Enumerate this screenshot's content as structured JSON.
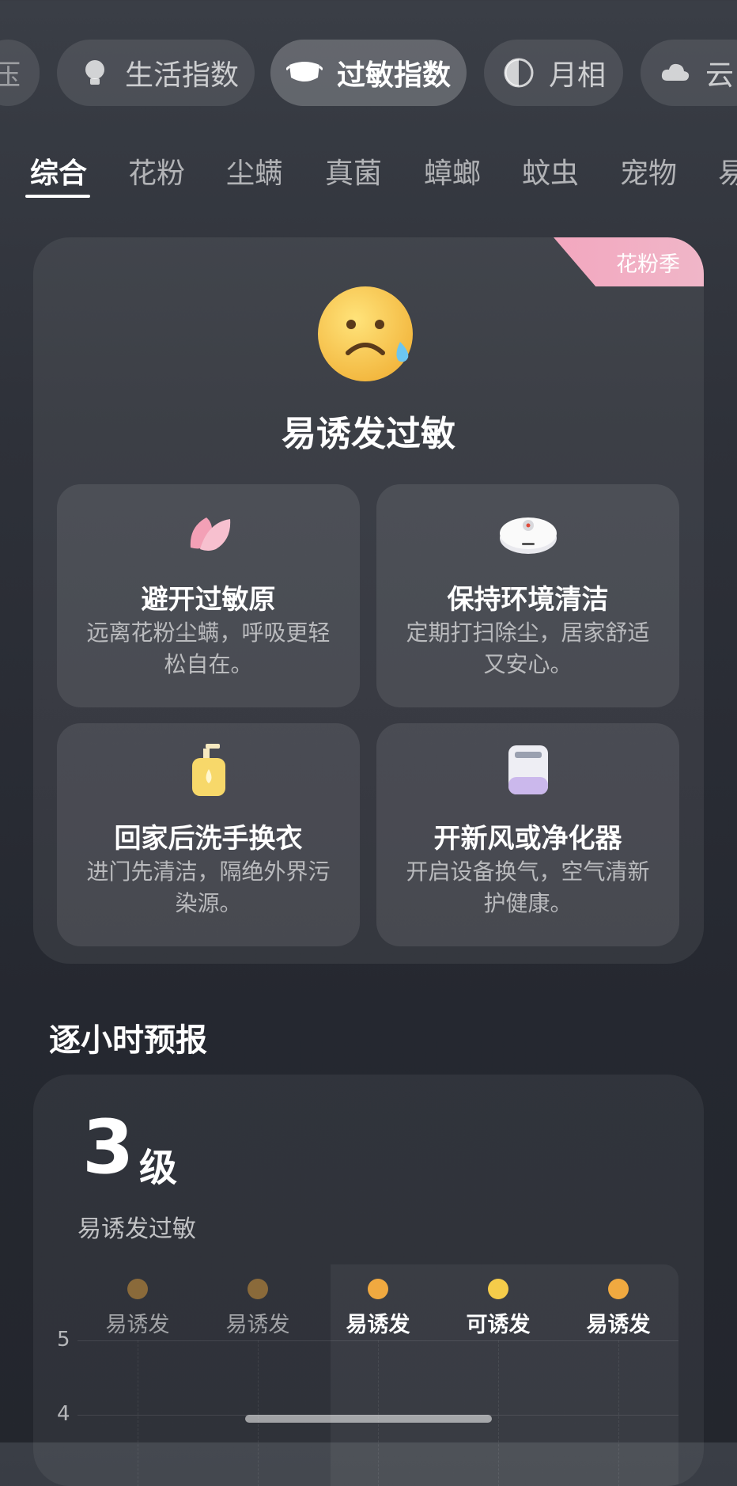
{
  "chips": [
    {
      "label": "压",
      "icon": "gauge-icon"
    },
    {
      "label": "生活指数",
      "icon": "lightbulb-icon"
    },
    {
      "label": "过敏指数",
      "icon": "mask-icon",
      "active": true
    },
    {
      "label": "月相",
      "icon": "moon-phase-icon"
    },
    {
      "label": "云",
      "icon": "cloud-icon"
    }
  ],
  "tabs": [
    "综合",
    "花粉",
    "尘螨",
    "真菌",
    "蟑螂",
    "蚊虫",
    "宠物",
    "易"
  ],
  "card": {
    "season_badge": "花粉季",
    "status": "易诱发过敏",
    "tips": [
      {
        "title": "避开过敏原",
        "desc": "远离花粉尘螨，呼吸更轻松自在。",
        "icon": "petal-icon"
      },
      {
        "title": "保持环境清洁",
        "desc": "定期打扫除尘，居家舒适又安心。",
        "icon": "robot-vacuum-icon"
      },
      {
        "title": "回家后洗手换衣",
        "desc": "进门先清洁，隔绝外界污染源。",
        "icon": "soap-bottle-icon"
      },
      {
        "title": "开新风或净化器",
        "desc": "开启设备换气，空气清新护健康。",
        "icon": "air-purifier-icon"
      }
    ]
  },
  "forecast": {
    "section_title": "逐小时预报",
    "level_value": "3",
    "level_unit": "级",
    "level_desc": "易诱发过敏",
    "hours": [
      {
        "label": "易诱发",
        "color": "#8a6a3a"
      },
      {
        "label": "易诱发",
        "color": "#8a6a3a"
      },
      {
        "label": "易诱发",
        "color": "#f0a940"
      },
      {
        "label": "可诱发",
        "color": "#f5cc4a"
      },
      {
        "label": "易诱发",
        "color": "#f0a940"
      }
    ],
    "y_ticks": [
      "5",
      "4"
    ]
  }
}
